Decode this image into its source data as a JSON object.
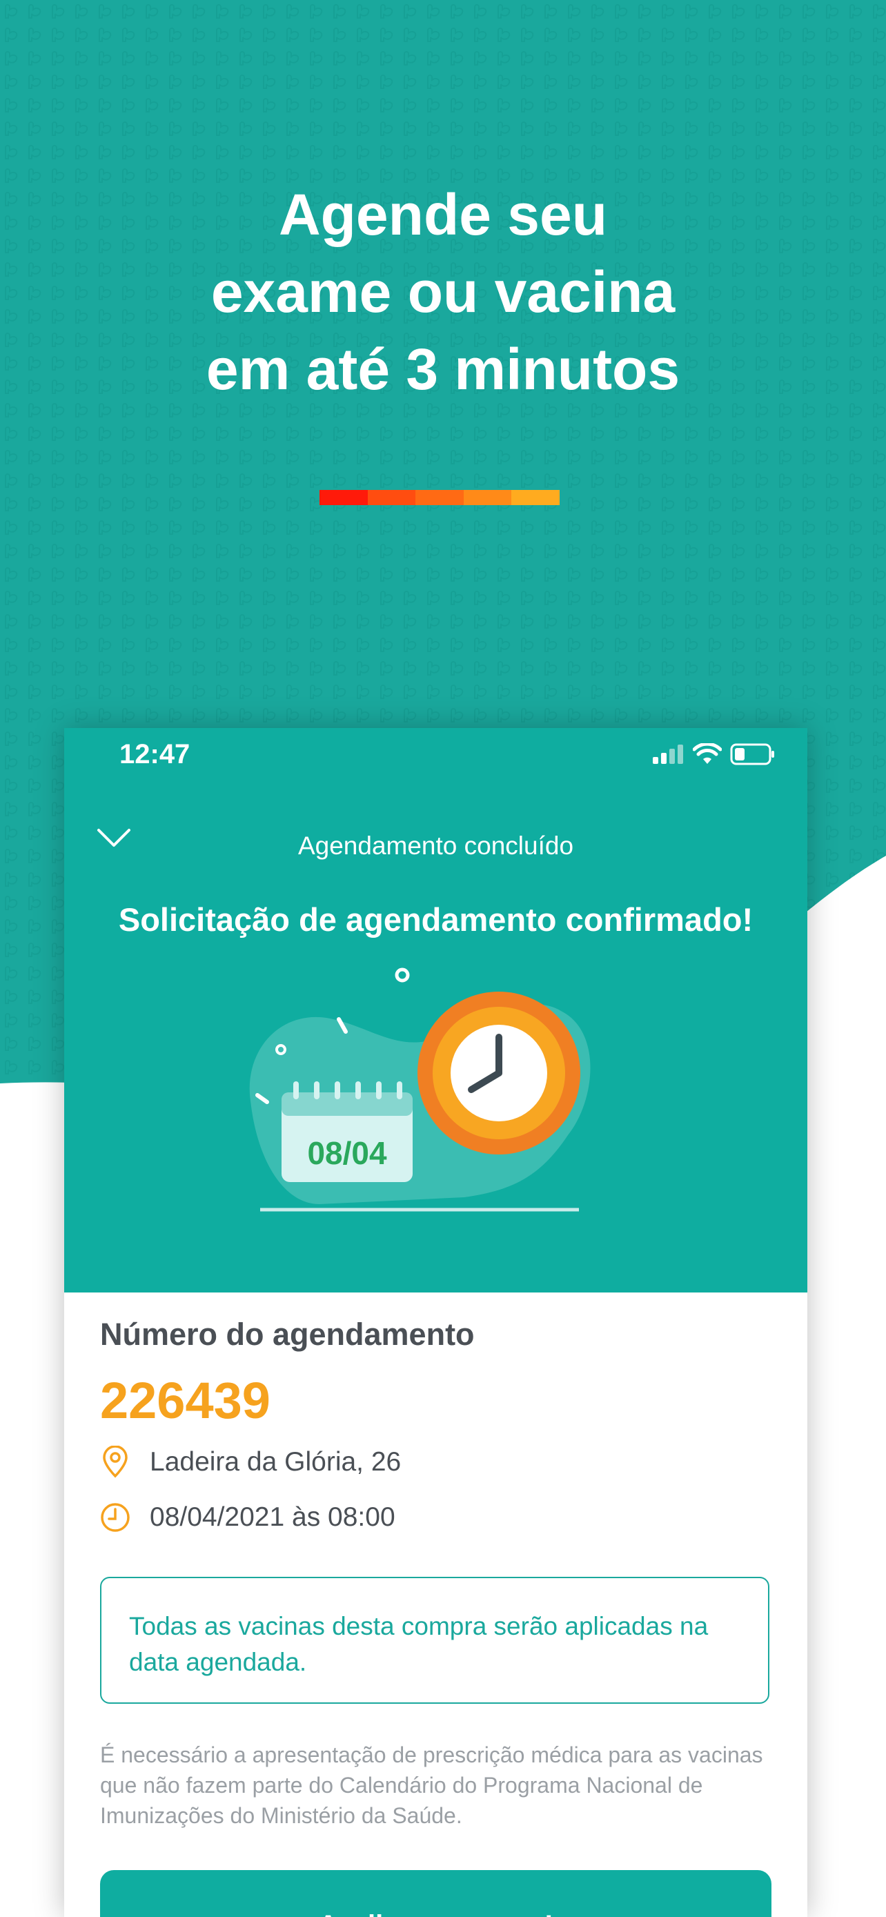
{
  "hero": {
    "headline_line1": "Agende seu",
    "headline_line2": "exame ou vacina",
    "headline_line3": "em até 3 minutos"
  },
  "colors": {
    "teal": "#1aa89d",
    "orange": "#f6a21e",
    "accent_bar": [
      "#ff1a0a",
      "#ff4d10",
      "#ff6a14",
      "#ff8a18",
      "#ffab1f"
    ]
  },
  "status_bar": {
    "time": "12:47",
    "icons": [
      "signal-icon",
      "wifi-icon",
      "battery-icon"
    ]
  },
  "nav": {
    "back_icon": "chevron-down-icon",
    "title": "Agendamento concluído"
  },
  "confirmation": {
    "title": "Solicitação de agendamento confirmado!",
    "calendar_date": "08/04"
  },
  "details": {
    "number_label": "Número do agendamento",
    "number_value": "226439",
    "address": "Ladeira da Glória, 26",
    "datetime": "08/04/2021 às 08:00"
  },
  "notice": {
    "text": "Todas as vacinas desta compra serão aplicadas na data agendada."
  },
  "prescription_note": "É necessário a apresentação de prescrição médica para as vacinas que não fazem parte do Calendário do Programa Nacional de Imunizações do Ministério da Saúde.",
  "button": {
    "label": "Avalie nosso app!"
  }
}
